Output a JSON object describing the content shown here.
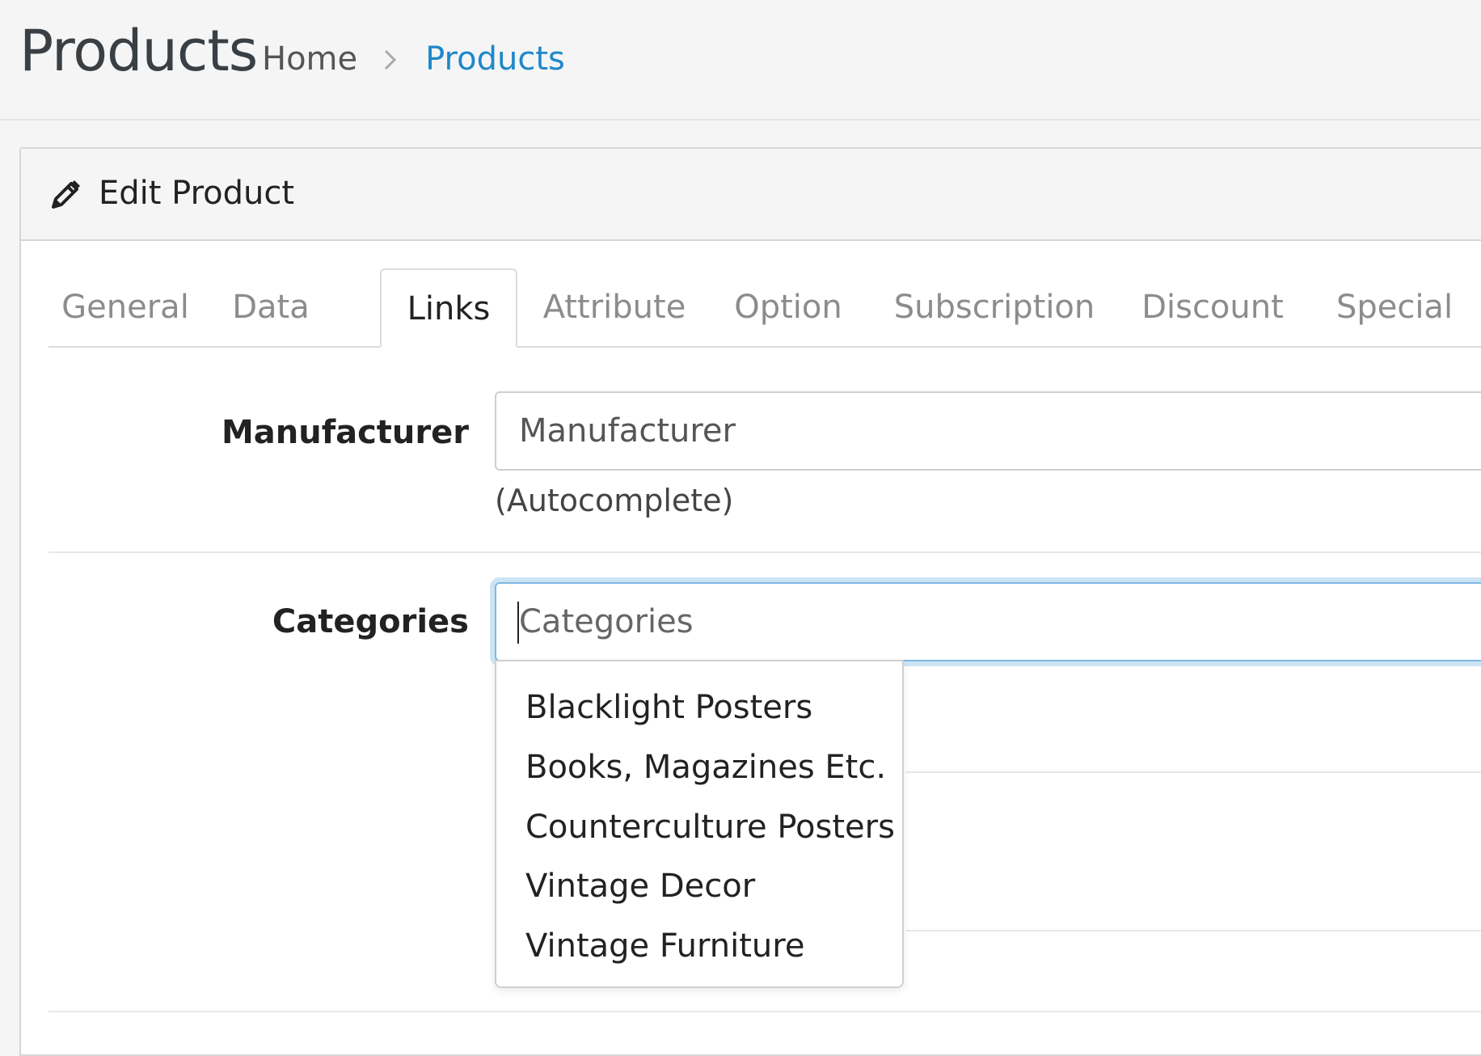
{
  "header": {
    "title": "Products",
    "breadcrumb": {
      "home": "Home",
      "current": "Products"
    }
  },
  "card": {
    "title": "Edit Product",
    "icon": "pencil-icon"
  },
  "tabs": [
    {
      "label": "General",
      "active": false
    },
    {
      "label": "Data",
      "active": false
    },
    {
      "label": "Links",
      "active": true
    },
    {
      "label": "Attribute",
      "active": false
    },
    {
      "label": "Option",
      "active": false
    },
    {
      "label": "Subscription",
      "active": false
    },
    {
      "label": "Discount",
      "active": false
    },
    {
      "label": "Special",
      "active": false
    }
  ],
  "form": {
    "manufacturer": {
      "label": "Manufacturer",
      "placeholder": "Manufacturer",
      "value": "",
      "help": "(Autocomplete)"
    },
    "categories": {
      "label": "Categories",
      "placeholder": "Categories",
      "value": "",
      "suggestions": [
        "Blacklight Posters",
        "Books, Magazines Etc.",
        "Counterculture Posters",
        "Vintage Decor",
        "Vintage Furniture"
      ]
    }
  },
  "colors": {
    "link": "#1e88c9",
    "focus_border": "#7db7e3",
    "focus_glow": "#cde4f5",
    "muted_tab": "#8c8c8c"
  }
}
